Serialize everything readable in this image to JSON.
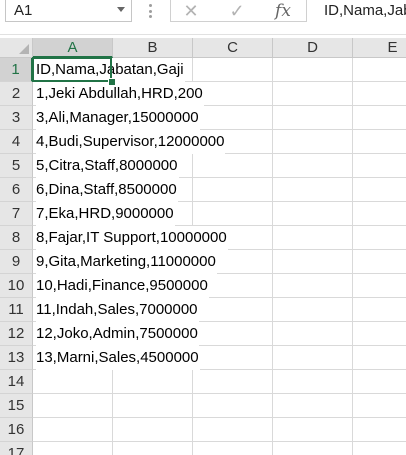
{
  "name_box": {
    "value": "A1"
  },
  "formula_bar": {
    "fx_label": "fx",
    "cancel_glyph": "✕",
    "enter_glyph": "✓",
    "content": "ID,Nama,Jabatan,Gaji"
  },
  "columns": [
    {
      "label": "A",
      "selected": true
    },
    {
      "label": "B",
      "selected": false
    },
    {
      "label": "C",
      "selected": false
    },
    {
      "label": "D",
      "selected": false
    },
    {
      "label": "E",
      "selected": false
    }
  ],
  "rows": [
    {
      "label": "1",
      "selected": true,
      "a": "ID,Nama,Jabatan,Gaji"
    },
    {
      "label": "2",
      "selected": false,
      "a": "1,Jeki Abdullah,HRD,200"
    },
    {
      "label": "3",
      "selected": false,
      "a": "3,Ali,Manager,15000000"
    },
    {
      "label": "4",
      "selected": false,
      "a": "4,Budi,Supervisor,12000000"
    },
    {
      "label": "5",
      "selected": false,
      "a": "5,Citra,Staff,8000000"
    },
    {
      "label": "6",
      "selected": false,
      "a": "6,Dina,Staff,8500000"
    },
    {
      "label": "7",
      "selected": false,
      "a": "7,Eka,HRD,9000000"
    },
    {
      "label": "8",
      "selected": false,
      "a": "8,Fajar,IT Support,10000000"
    },
    {
      "label": "9",
      "selected": false,
      "a": "9,Gita,Marketing,11000000"
    },
    {
      "label": "10",
      "selected": false,
      "a": "10,Hadi,Finance,9500000"
    },
    {
      "label": "11",
      "selected": false,
      "a": "11,Indah,Sales,7000000"
    },
    {
      "label": "12",
      "selected": false,
      "a": "12,Joko,Admin,7500000"
    },
    {
      "label": "13",
      "selected": false,
      "a": "13,Marni,Sales,4500000"
    },
    {
      "label": "14",
      "selected": false,
      "a": ""
    },
    {
      "label": "15",
      "selected": false,
      "a": ""
    },
    {
      "label": "16",
      "selected": false,
      "a": ""
    },
    {
      "label": "17",
      "selected": false,
      "a": ""
    }
  ],
  "colors": {
    "accent": "#217346",
    "header_bg": "#e6e6e6",
    "gridline": "#d9d9d9"
  }
}
